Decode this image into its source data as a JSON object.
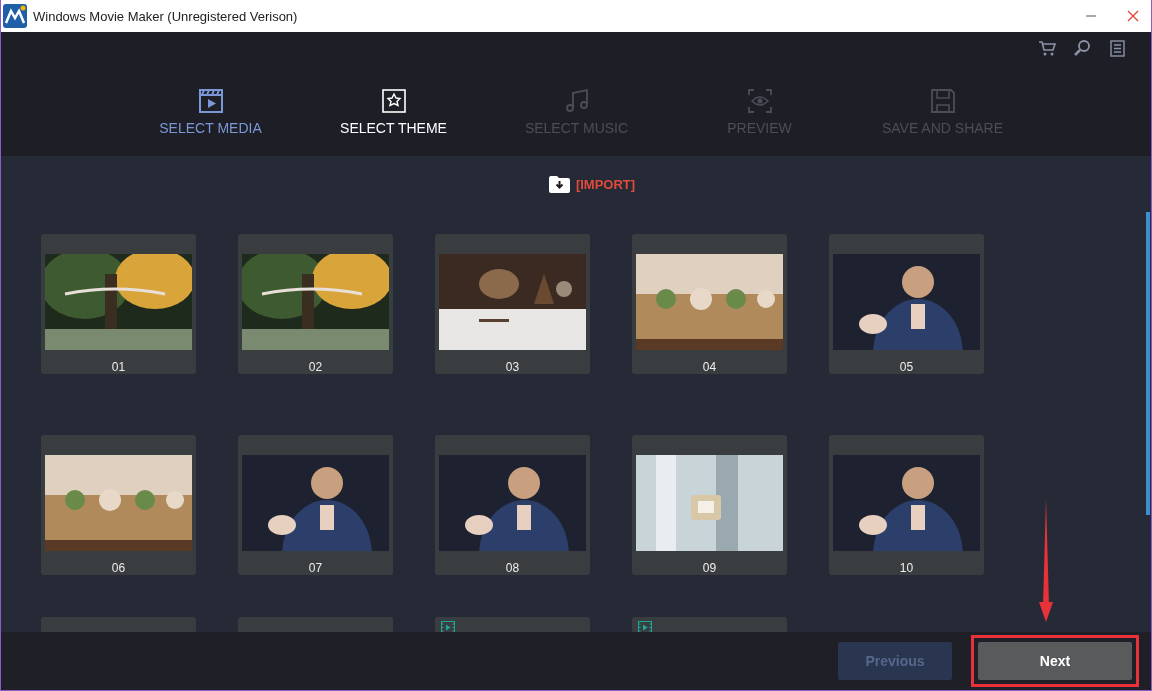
{
  "window": {
    "title": "Windows Movie Maker (Unregistered Verison)"
  },
  "steps": [
    {
      "label": "SELECT MEDIA",
      "selected": false,
      "disabled": false
    },
    {
      "label": "SELECT THEME",
      "selected": true,
      "disabled": false
    },
    {
      "label": "SELECT MUSIC",
      "selected": false,
      "disabled": true
    },
    {
      "label": "PREVIEW",
      "selected": false,
      "disabled": true
    },
    {
      "label": "SAVE AND SHARE",
      "selected": false,
      "disabled": true
    }
  ],
  "import": {
    "label": "[IMPORT]"
  },
  "media": [
    {
      "label": "01",
      "video": false
    },
    {
      "label": "02",
      "video": false
    },
    {
      "label": "03",
      "video": false
    },
    {
      "label": "04",
      "kind": "picture",
      "video": false
    },
    {
      "label": "05",
      "video": false
    },
    {
      "label": "06",
      "kind": "picture",
      "video": false
    },
    {
      "label": "07",
      "video": false
    },
    {
      "label": "08",
      "video": false
    },
    {
      "label": "09",
      "video": false
    },
    {
      "label": "10",
      "video": false
    },
    {
      "video": false
    },
    {
      "video": false
    },
    {
      "video": true
    },
    {
      "video": true
    }
  ],
  "buttons": [
    {
      "label": "Previous",
      "disabled": true
    },
    {
      "label": "Next",
      "disabled": false,
      "highlighted": true
    }
  ]
}
